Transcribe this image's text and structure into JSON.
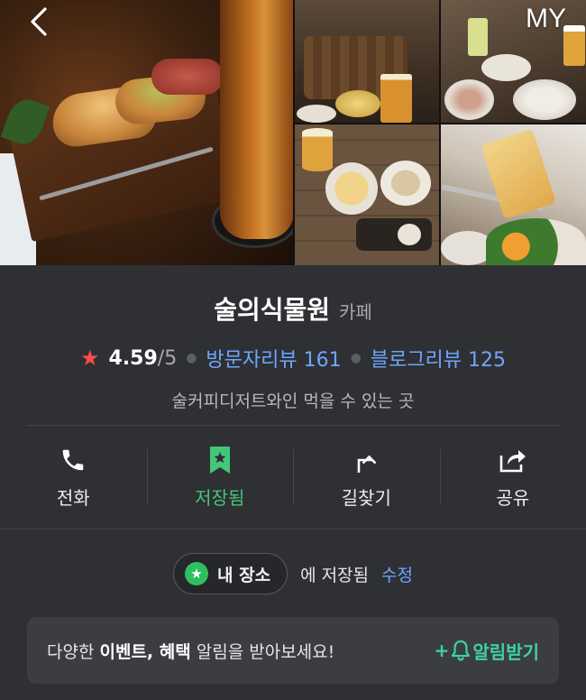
{
  "header": {
    "my_label": "MY"
  },
  "place": {
    "name": "술의식물원",
    "category": "카페",
    "rating": "4.59",
    "rating_max": "/5",
    "visitor_review": "방문자리뷰 161",
    "blog_review": "블로그리뷰 125",
    "description": "술커피디저트와인 먹을 수 있는 곳"
  },
  "actions": {
    "call": "전화",
    "save": "저장됨",
    "directions": "길찾기",
    "share": "공유"
  },
  "saved": {
    "folder": "내 장소",
    "suffix": "에 저장됨",
    "edit": "수정"
  },
  "banner": {
    "pre": "다양한 ",
    "bold": "이벤트, 혜택",
    "post": " 알림을 받아보세요!",
    "button": "+알림받기"
  },
  "colors": {
    "background": "#2f3033",
    "link": "#6da6ff",
    "saved_green": "#42c67a",
    "star_red": "#ff4a4a",
    "alert_teal": "#3fd0a8"
  },
  "icons": [
    "back-icon",
    "phone-icon",
    "bookmark-star-icon",
    "directions-arrow-icon",
    "share-icon",
    "star-icon",
    "bell-icon"
  ]
}
